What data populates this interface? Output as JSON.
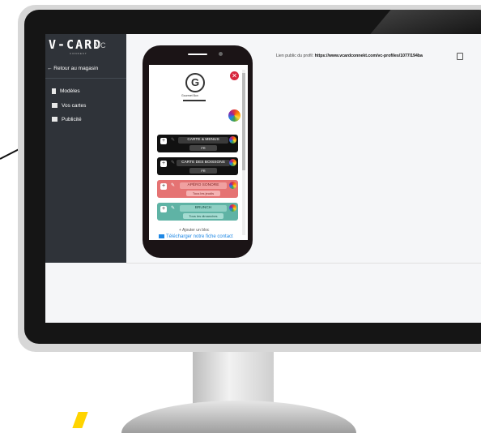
{
  "brand": {
    "logo": "V-CARD",
    "suffix": "VC",
    "sub": "CONNEKT"
  },
  "sidebar": {
    "back_label": "← Retour au magasin",
    "items": [
      {
        "label": "Modèles",
        "icon": "document-icon"
      },
      {
        "label": "Vos cartes",
        "icon": "card-icon"
      },
      {
        "label": "Publicité",
        "icon": "card-icon"
      }
    ]
  },
  "main": {
    "public_link_label": "Lien public du profil:",
    "public_link_url": "https://www.vcardconnekt.com/vc-profiles/1077/194ba"
  },
  "phone": {
    "brand_initial": "G",
    "brand_name": "Gourmet Bon",
    "blocks": [
      {
        "title": "CARTE & MENUS",
        "subtitle": "FR",
        "color": "#111111"
      },
      {
        "title": "CARTE DES BOISSONS",
        "subtitle": "FR",
        "color": "#111111"
      },
      {
        "title": "APÉRO SONORE",
        "subtitle": "Tous les jeudis",
        "color": "#e57373"
      },
      {
        "title": "BRUNCH",
        "subtitle": "Tous les dimanches",
        "color": "#5fb3a5"
      }
    ],
    "add_block_label": "+ Ajouter un bloc",
    "download_label": "Télécharger notre fiche contact"
  },
  "colors": {
    "sidebar": "#2f3339",
    "close": "#d7263d",
    "link": "#1e88e5"
  }
}
